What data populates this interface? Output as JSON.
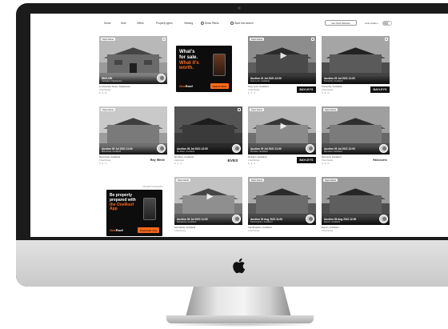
{
  "nav": {
    "items": [
      "Home",
      "Sold",
      "Offers",
      "Property types",
      "Viewing",
      "Show Filters",
      "Save this search"
    ],
    "button_label": "Get Sold Website",
    "toggle_label": "Hide Hidden"
  },
  "cards": [
    {
      "tag": "Open Home",
      "line1": "$849,000",
      "line2": "Auckland, Papatoetoe",
      "addr": "12 Example Street, Papatoetoe",
      "sub": "4 bed house",
      "feat": "4 · 2 · 2",
      "brand": "",
      "video": false
    },
    {
      "tag": "Open Home",
      "line1": "Auction 24 Jul 2021 12:00",
      "line2": "Grey Lynn, Auckland",
      "addr": "Grey Lynn, Auckland",
      "sub": "3 bed house",
      "feat": "3 · 1 · 1",
      "brand": "BAYLEYS",
      "video": true
    },
    {
      "tag": "",
      "line1": "Auction 29 Jul 2021 11:00",
      "line2": "Ponsonby, Auckland",
      "addr": "Ponsonby, Auckland",
      "sub": "4 bed house",
      "feat": "4 · 2 · 2",
      "brand": "BAYLEYS",
      "video": false
    },
    {
      "tag": "Open Home",
      "line1": "Auction 28 Jul 2021 11:00",
      "line2": "Manurewa, Auckland",
      "addr": "Manurewa, Auckland",
      "sub": "3 bed house",
      "feat": "3 · 1 · 1",
      "brand": "Ray White",
      "video": false
    },
    {
      "tag": "",
      "line1": "Auction 28 Jul 2021 12:00",
      "line2": "Mt Albert, Auckland",
      "addr": "Mt Albert, Auckland",
      "sub": "Apartment",
      "feat": "2 · 1 · 1",
      "brand": "EVES",
      "video": false
    },
    {
      "tag": "Open Home",
      "line1": "Auction 29 Jul 2021 11:00",
      "line2": "Mt Eden, Auckland",
      "addr": "Mt Eden, Auckland",
      "sub": "4 bed house",
      "feat": "4 · 2 · 1",
      "brand": "BAYLEYS",
      "video": true
    },
    {
      "tag": "Open Home",
      "line1": "Auction 29 Jul 2021 12:00",
      "line2": "Remuera, Auckland",
      "addr": "Remuera, Auckland",
      "sub": "3 bed house",
      "feat": "3 · 2 · 2",
      "brand": "Harcourts",
      "video": false
    },
    {
      "tag": "Open Home",
      "line1": "Auction 28 Jul 2021 11:00",
      "line2": "Glendowie, Auckland",
      "addr": "Glendowie, Auckland",
      "sub": "4 bed house",
      "feat": "4 · 2 · 2",
      "brand": "",
      "video": true
    },
    {
      "tag": "Open Home",
      "line1": "Auction 04 Aug 2021 11:00",
      "line2": "Sandringham, Auckland",
      "addr": "Sandringham, Auckland",
      "sub": "3 bed house",
      "feat": "3 · 1 · 1",
      "brand": "",
      "video": false
    },
    {
      "tag": "Open Home",
      "line1": "Auction 05 Aug 2021 12:00",
      "line2": "Epsom, Auckland",
      "addr": "Epsom, Auckland",
      "sub": "4 bed house",
      "feat": "4 · 2 · 2",
      "brand": "",
      "video": false
    }
  ],
  "ad1": {
    "line1": "What's",
    "line2": "for sale.",
    "line3": "What it's",
    "line4": "worth.",
    "logo_a": "One",
    "logo_b": "Roof",
    "cta": "Search Now"
  },
  "ad2": {
    "label": "ADVERTISEMENT",
    "line1": "Be property",
    "line2": "prepared with",
    "line3": "the OneRoof App",
    "logo_a": "One",
    "logo_b": "Roof",
    "cta": "Download now"
  },
  "colors": {
    "accent": "#ff6a1a",
    "bezel": "#1b1b1b",
    "chin": "#d6d6d6"
  },
  "icons": [
    "apple-logo-icon",
    "play-icon",
    "heart-icon"
  ]
}
